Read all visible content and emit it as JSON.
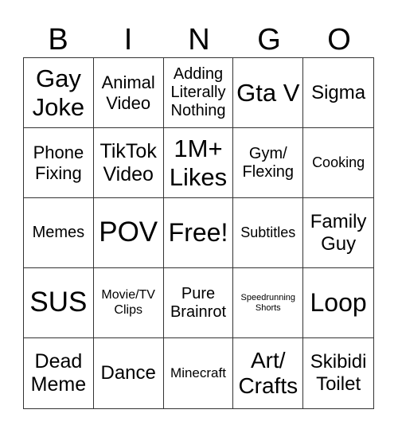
{
  "header": {
    "letters": [
      "B",
      "I",
      "N",
      "G",
      "O"
    ]
  },
  "cells": [
    "Gay Joke",
    "Animal Video",
    "Adding Literally Nothing",
    "Gta V",
    "Sigma",
    "Phone Fixing",
    "TikTok Video",
    "1M+ Likes",
    "Gym/ Flexing",
    "Cooking",
    "Memes",
    "POV",
    "Free!",
    "Subtitles",
    "Family Guy",
    "SUS",
    "Movie/TV Clips",
    "Pure Brainrot",
    "Speedrunning Shorts",
    "Loop",
    "Dead Meme",
    "Dance",
    "Minecraft",
    "Art/ Crafts",
    "Skibidi Toilet"
  ]
}
